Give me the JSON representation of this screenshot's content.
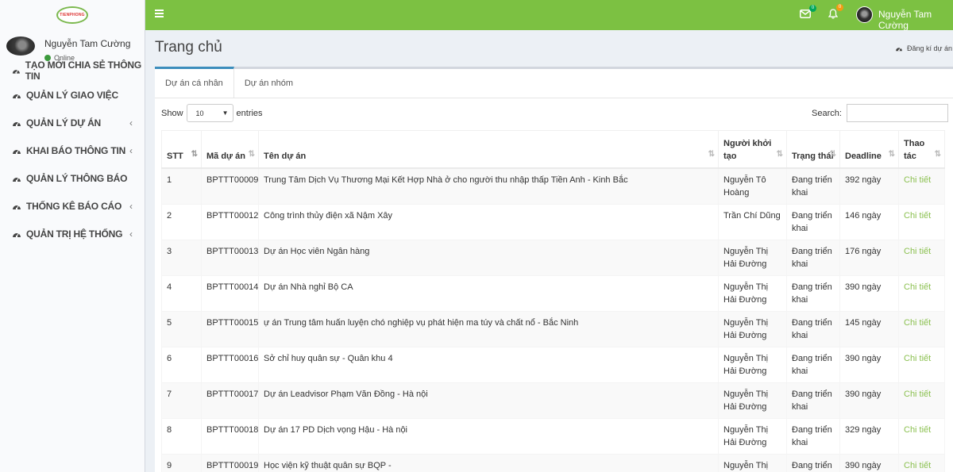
{
  "sidebar": {
    "logo_text": "TIENPHONG",
    "user_name": "Nguyễn Tam Cường",
    "user_status": "Online",
    "items": [
      {
        "label": "TẠO MỚI CHIA SẺ THÔNG TIN",
        "chevron": ""
      },
      {
        "label": "QUẢN LÝ GIAO VIỆC",
        "chevron": ""
      },
      {
        "label": "QUẢN LÝ DỰ ÁN",
        "chevron": "‹"
      },
      {
        "label": "KHAI BÁO THÔNG TIN",
        "chevron": "‹"
      },
      {
        "label": "QUẢN LÝ THÔNG BÁO",
        "chevron": ""
      },
      {
        "label": "THỐNG KÊ BÁO CÁO",
        "chevron": "‹"
      },
      {
        "label": "QUẢN TRỊ HỆ THỐNG",
        "chevron": "‹"
      }
    ]
  },
  "header": {
    "mail_badge": "0",
    "bell_badge": "0",
    "user_name": "Nguyễn Tam Cường"
  },
  "page": {
    "title": "Trang chủ",
    "register_link": "Đăng kí dự án"
  },
  "tabs": [
    {
      "label": "Dự án cá nhân"
    },
    {
      "label": "Dự án nhóm"
    }
  ],
  "controls": {
    "show_label": "Show",
    "entries_value": "10",
    "entries_label": "entries",
    "search_label": "Search:",
    "search_value": ""
  },
  "table": {
    "headers": [
      "STT",
      "Mã dự án",
      "Tên dự án",
      "Người khởi tạo",
      "Trạng thái",
      "Deadline",
      "Thao tác"
    ],
    "rows": [
      {
        "stt": "1",
        "ma": "BPTTT00009",
        "ten": "Trung Tâm Dịch Vụ Thương Mại Kết Hợp Nhà ở cho người thu nhập thấp Tiền Anh - Kinh Bắc",
        "nguoi": "Nguyễn Tô Hoàng",
        "trangthai": "Đang triển khai",
        "deadline": "392 ngày",
        "action": "Chi tiết"
      },
      {
        "stt": "2",
        "ma": "BPTTT00012",
        "ten": "Công trình thủy điện xã Nậm Xây",
        "nguoi": "Trần Chí Dũng",
        "trangthai": "Đang triển khai",
        "deadline": "146 ngày",
        "action": "Chi tiết"
      },
      {
        "stt": "3",
        "ma": "BPTTT00013",
        "ten": "Dự án Học viên Ngân hàng",
        "nguoi": "Nguyễn Thị Hải Đường",
        "trangthai": "Đang triển khai",
        "deadline": "176 ngày",
        "action": "Chi tiết"
      },
      {
        "stt": "4",
        "ma": "BPTTT00014",
        "ten": "Dự án Nhà nghỉ Bộ CA",
        "nguoi": "Nguyễn Thị Hải Đường",
        "trangthai": "Đang triển khai",
        "deadline": "390 ngày",
        "action": "Chi tiết"
      },
      {
        "stt": "5",
        "ma": "BPTTT00015",
        "ten": "ự án Trung tâm huấn luyện chó nghiệp vụ phát hiện ma túy và chất nổ - Bắc Ninh",
        "nguoi": "Nguyễn Thị Hải Đường",
        "trangthai": "Đang triển khai",
        "deadline": "145 ngày",
        "action": "Chi tiết"
      },
      {
        "stt": "6",
        "ma": "BPTTT00016",
        "ten": "Sở chỉ huy quân sự - Quân khu 4",
        "nguoi": "Nguyễn Thị Hải Đường",
        "trangthai": "Đang triển khai",
        "deadline": "390 ngày",
        "action": "Chi tiết"
      },
      {
        "stt": "7",
        "ma": "BPTTT00017",
        "ten": "Dự án Leadvisor Phạm Văn Đồng - Hà nội",
        "nguoi": "Nguyễn Thị Hải Đường",
        "trangthai": "Đang triển khai",
        "deadline": "390 ngày",
        "action": "Chi tiết"
      },
      {
        "stt": "8",
        "ma": "BPTTT00018",
        "ten": "Dự án 17 PD Dịch vọng Hậu - Hà nội",
        "nguoi": "Nguyễn Thị Hải Đường",
        "trangthai": "Đang triển khai",
        "deadline": "329 ngày",
        "action": "Chi tiết"
      },
      {
        "stt": "9",
        "ma": "BPTTT00019",
        "ten": "Học viện kỹ thuật quân sự BQP -",
        "nguoi": "Nguyễn Thị Hải",
        "trangthai": "Đang triển",
        "deadline": "390 ngày",
        "action": "Chi tiết"
      }
    ]
  },
  "colors": {
    "header_green": "#7cc142",
    "link_green": "#8cc152",
    "tab_blue": "#3c8dbc"
  },
  "icons": {
    "menu": "dashboard-icon",
    "mail": "envelope-icon",
    "bell": "bell-icon",
    "hamburger": "hamburger-icon"
  }
}
